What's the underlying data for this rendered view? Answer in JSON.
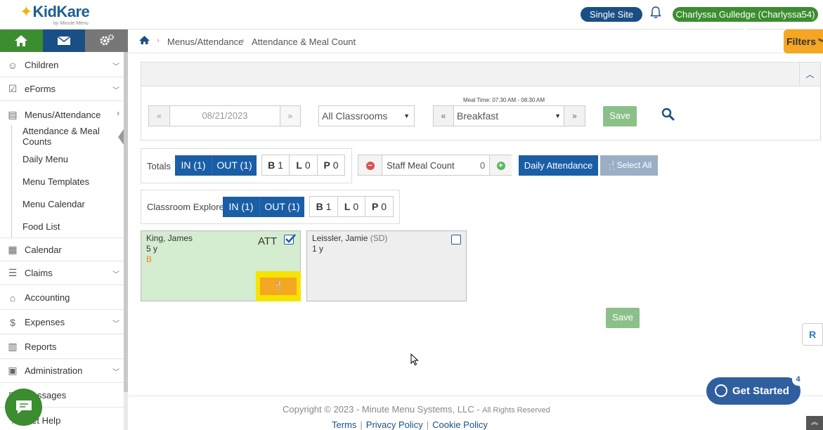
{
  "brand": {
    "name": "KidKare",
    "tagline": "by Minute Menu"
  },
  "topbar": {
    "single_site": "Single Site",
    "user": "Charlyssa Gulledge (Charlyssa54)"
  },
  "sidebar": {
    "items": [
      {
        "label": "Children",
        "icon": "child-icon"
      },
      {
        "label": "eForms",
        "icon": "form-check-icon"
      },
      {
        "label": "Menus/Attendance",
        "icon": "clipboard-icon"
      },
      {
        "label": "Calendar",
        "icon": "calendar-icon"
      },
      {
        "label": "Claims",
        "icon": "list-icon"
      },
      {
        "label": "Accounting",
        "icon": "bank-icon"
      },
      {
        "label": "Expenses",
        "icon": "dollar-icon"
      },
      {
        "label": "Reports",
        "icon": "report-icon"
      },
      {
        "label": "Administration",
        "icon": "briefcase-icon"
      },
      {
        "label": "Messages",
        "icon": "envelope-icon"
      },
      {
        "label": "Get Help",
        "icon": "help-icon"
      }
    ],
    "sub_items": [
      "Attendance & Meal Counts",
      "Daily Menu",
      "Menu Templates",
      "Menu Calendar",
      "Food List"
    ]
  },
  "breadcrumb": {
    "items": [
      "Menus/Attendance",
      "Attendance & Meal Count"
    ]
  },
  "filters_label": "Filters",
  "controls": {
    "date": "08/21/2023",
    "classroom": "All Classrooms",
    "meal_time": "Meal Time: 07:30 AM - 08:30 AM",
    "meal": "Breakfast",
    "save": "Save"
  },
  "totals": {
    "label": "Totals",
    "in": "IN (1)",
    "out": "OUT (1)",
    "b_letter": "B",
    "b_count": "1",
    "l_letter": "L",
    "l_count": "0",
    "p_letter": "P",
    "p_count": "0"
  },
  "staff": {
    "label": "Staff Meal Count",
    "count": "0"
  },
  "daily_attendance": "Daily Attendance",
  "select_all": "Select All",
  "classroom_row": {
    "label": "Classroom Explore",
    "in": "IN (1)",
    "out": "OUT (1)",
    "b_letter": "B",
    "b_count": "1",
    "l_letter": "L",
    "l_count": "0",
    "p_letter": "P",
    "p_count": "0"
  },
  "children": [
    {
      "name": "King, James",
      "age": "5 y",
      "meal": "B",
      "status": "ATT",
      "checked": true
    },
    {
      "name": "Leissler, Jamie",
      "tag": "(SD)",
      "age": "1 y",
      "checked": false
    }
  ],
  "bottom_save": "Save",
  "footer": {
    "copyright": "Copyright © 2023 - Minute Menu Systems, LLC - ",
    "rights": "All Rights Reserved",
    "links": [
      "Terms",
      "Privacy Policy",
      "Cookie Policy"
    ]
  },
  "get_started": {
    "label": "Get Started",
    "badge": "4"
  },
  "colors": {
    "green": "#3b8d2f",
    "navy": "#1a4f85",
    "blue": "#1a5ea6",
    "orange": "#f5a623",
    "highlight": "#f5e400"
  }
}
